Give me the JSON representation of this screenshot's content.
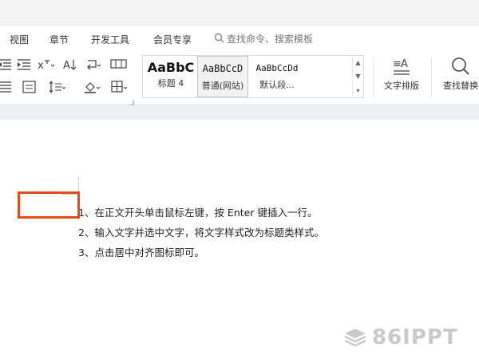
{
  "menubar": {
    "items": [
      "视图",
      "章节",
      "开发工具",
      "会员专享"
    ],
    "search_placeholder": "查找命令、搜索模板"
  },
  "ribbon": {
    "styles": [
      {
        "sample": "AaBbC",
        "name": "标题 4"
      },
      {
        "sample": "AaBbCcD",
        "name": "普通(网站)"
      },
      {
        "sample": "AaBbCcDd",
        "name": "默认段..."
      }
    ],
    "text_layout_label": "文字排版",
    "find_replace_label": "查找替换"
  },
  "document": {
    "lines": [
      "1、在正文开头单击鼠标左键，按 Enter 键插入一行。",
      "2、输入文字并选中文字，将文字样式改为标题类样式。",
      "3、点击居中对齐图标即可。"
    ]
  },
  "watermark": {
    "text": "86IPPT",
    "color": "#c9c9c9"
  },
  "colors": {
    "highlight": "#e64a19",
    "toolbar_bg": "#f3f3f3"
  }
}
